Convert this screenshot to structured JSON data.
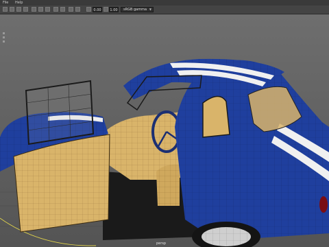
{
  "menubar": {
    "items": [
      "File",
      "Help"
    ]
  },
  "toolbar": {
    "icons": [
      "select-tool-icon",
      "move-tool-icon",
      "rotate-tool-icon",
      "scale-tool-icon",
      "grid-toggle-icon",
      "camera-icon",
      "lighting-icon",
      "shading-icon",
      "wireframe-icon",
      "isolate-icon",
      "texture-icon",
      "gamma-icon"
    ],
    "exposure_value": "0.00",
    "gamma_value": "1.00",
    "color_space": "sRGB gamma"
  },
  "viewport": {
    "camera_label": "persp",
    "colors": {
      "body": "#1f3f9e",
      "stripe": "#f0f0f0",
      "interior": "#d9b46a",
      "background": "#5d5d5d"
    }
  }
}
